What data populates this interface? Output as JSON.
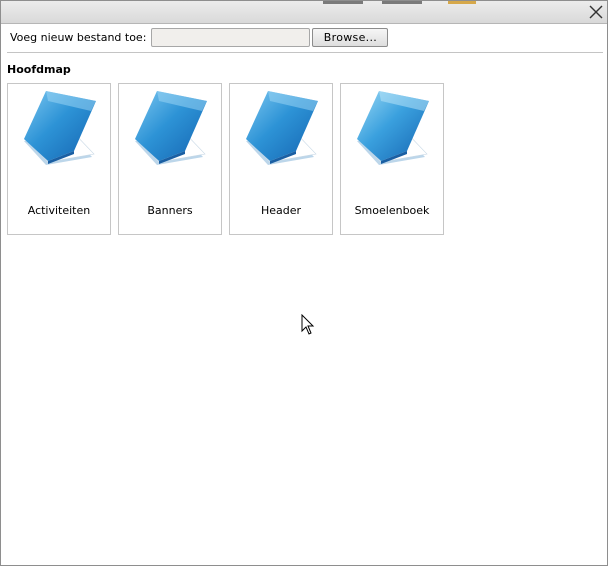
{
  "upload": {
    "label": "Voeg nieuw bestand toe:",
    "input_value": "",
    "browse_label": "Browse..."
  },
  "section": {
    "title": "Hoofdmap"
  },
  "folders": [
    {
      "name": "Activiteiten",
      "icon": "book-icon"
    },
    {
      "name": "Banners",
      "icon": "book-icon"
    },
    {
      "name": "Header",
      "icon": "book-icon"
    },
    {
      "name": "Smoelenboek",
      "icon": "book-icon"
    }
  ],
  "colors": {
    "book_blue": "#1f7fc8",
    "book_light": "#7cc7f0",
    "border": "#c6c6c6"
  }
}
